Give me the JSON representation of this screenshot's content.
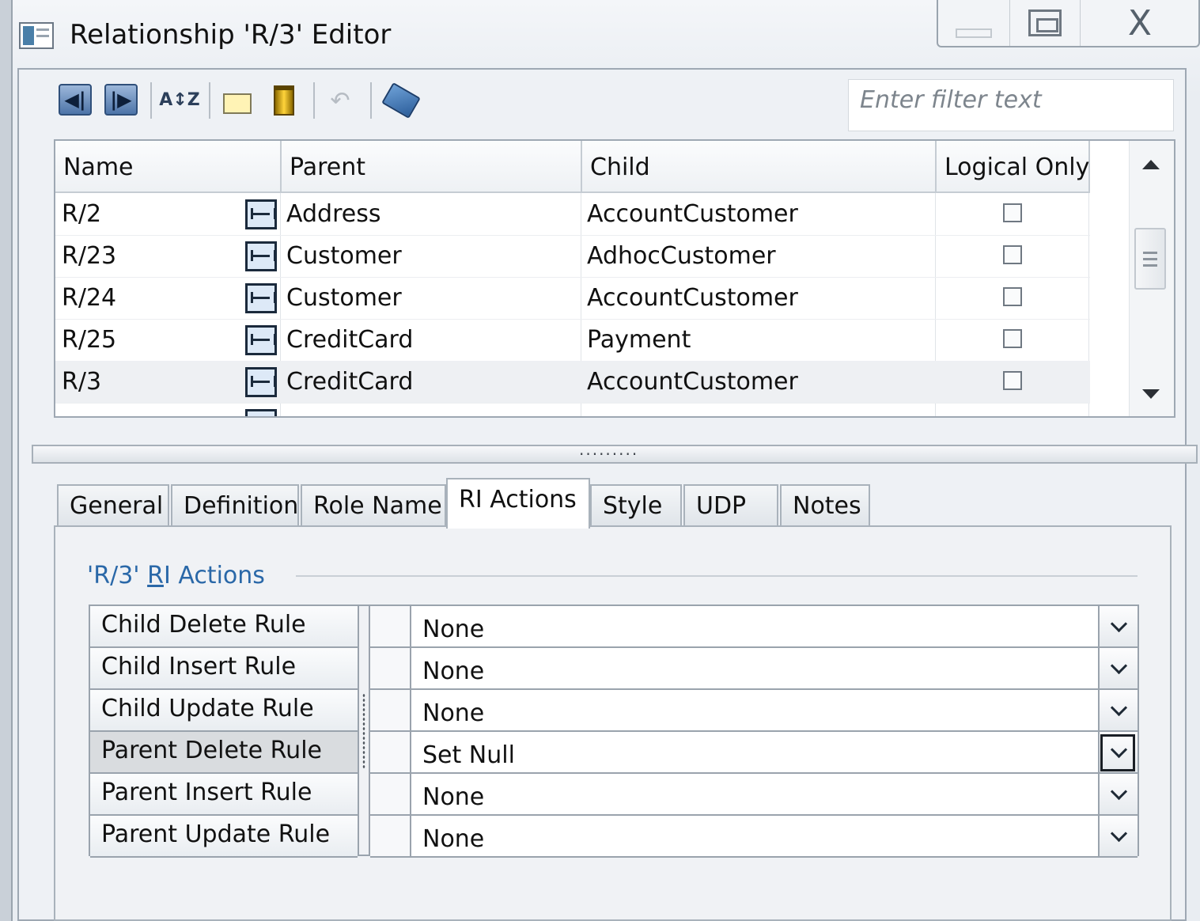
{
  "window": {
    "title": "Relationship 'R/3' Editor",
    "controls": {
      "close_glyph": "X"
    }
  },
  "toolbar": {
    "buttons": [
      {
        "name": "previous-icon",
        "glyph": "◀|"
      },
      {
        "name": "next-icon",
        "glyph": "|▶"
      },
      {
        "name": "sort-icon",
        "glyph": "A↕Z"
      },
      {
        "name": "new-icon"
      },
      {
        "name": "delete-icon"
      },
      {
        "name": "undo-icon",
        "glyph": "↶"
      },
      {
        "name": "properties-icon"
      }
    ],
    "filter_placeholder": "Enter filter text"
  },
  "grid": {
    "columns": [
      "Name",
      "Parent",
      "Child",
      "Logical Only"
    ],
    "rows": [
      {
        "name": "R/2",
        "parent": "Address",
        "child": "AccountCustomer",
        "logical_only": false
      },
      {
        "name": "R/23",
        "parent": "Customer",
        "child": "AdhocCustomer",
        "logical_only": false
      },
      {
        "name": "R/24",
        "parent": "Customer",
        "child": "AccountCustomer",
        "logical_only": false
      },
      {
        "name": "R/25",
        "parent": "CreditCard",
        "child": "Payment",
        "logical_only": false
      },
      {
        "name": "R/3",
        "parent": "CreditCard",
        "child": "AccountCustomer",
        "logical_only": false,
        "selected": true
      }
    ]
  },
  "tabs": [
    {
      "label": "General"
    },
    {
      "label": "Definition"
    },
    {
      "label": "Role Name"
    },
    {
      "label": "RI Actions",
      "active": true
    },
    {
      "label": "Style"
    },
    {
      "label": "UDP"
    },
    {
      "label": "Notes"
    }
  ],
  "ri_actions": {
    "group_title_prefix": "'R/3' ",
    "group_title_mnemonic": "R",
    "group_title_rest": "I Actions",
    "rules": [
      {
        "label": "Child Delete Rule",
        "value": "None"
      },
      {
        "label": "Child Insert Rule",
        "value": "None"
      },
      {
        "label": "Child Update Rule",
        "value": "None"
      },
      {
        "label": "Parent Delete Rule",
        "value": "Set Null",
        "selected": true
      },
      {
        "label": "Parent Insert Rule",
        "value": "None"
      },
      {
        "label": "Parent Update Rule",
        "value": "None"
      }
    ]
  },
  "colors": {
    "accent_text": "#2a68a8",
    "window_bg": "#e9edf2",
    "selected_row": "#eef0f3"
  }
}
